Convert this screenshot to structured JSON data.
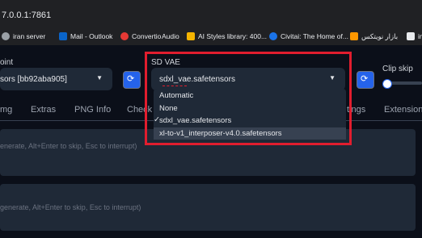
{
  "browser": {
    "url": "7.0.0.1:7861",
    "bookmarks": [
      {
        "label": "iran server",
        "icon": "globe-icon",
        "color": "#9aa0a6"
      },
      {
        "label": "Mail - Outlook",
        "icon": "outlook-icon",
        "color": "#0a64c8"
      },
      {
        "label": "Convertio",
        "icon": "convertio-icon",
        "color": "#e53935"
      },
      {
        "label": "Audio",
        "icon": "audio-icon",
        "color": "#e8eaed"
      },
      {
        "label": "AI Styles library: 400...",
        "icon": "ai-styles-icon",
        "color": "#f4b400"
      },
      {
        "label": "Civitai: The Home of...",
        "icon": "civitai-icon",
        "color": "#1a73e8"
      },
      {
        "label": "بازار نویتکس",
        "icon": "bazaar-icon",
        "color": "#ff9800"
      },
      {
        "label": "im",
        "icon": "image-icon",
        "color": "#e8eaed"
      }
    ]
  },
  "checkpoint": {
    "label": "oint",
    "value": "sors [bb92aba905]",
    "refresh_icon": "refresh-icon"
  },
  "sd_vae": {
    "label": "SD VAE",
    "value": "sdxl_vae.safetensors",
    "refresh_icon": "refresh-icon",
    "options": [
      "Automatic",
      "None",
      "sdxl_vae.safetensors",
      "xl-to-v1_interposer-v4.0.safetensors"
    ],
    "selected_index": 2,
    "highlighted_index": 3,
    "check_mark": "✓"
  },
  "clip_skip": {
    "label": "Clip skip",
    "value_fraction": 0.05
  },
  "tabs": [
    "mg",
    "Extras",
    "PNG Info",
    "Check",
    "tings",
    "Extension"
  ],
  "prompts": {
    "positive_placeholder": "enerate, Alt+Enter to skip, Esc to interrupt)",
    "negative_placeholder": "generate, Alt+Enter to skip, Esc to interrupt)"
  },
  "colors": {
    "highlight_box": "#e11d2e",
    "accent": "#2563eb",
    "background": "#0b0f19",
    "input_bg": "#1f2937"
  }
}
